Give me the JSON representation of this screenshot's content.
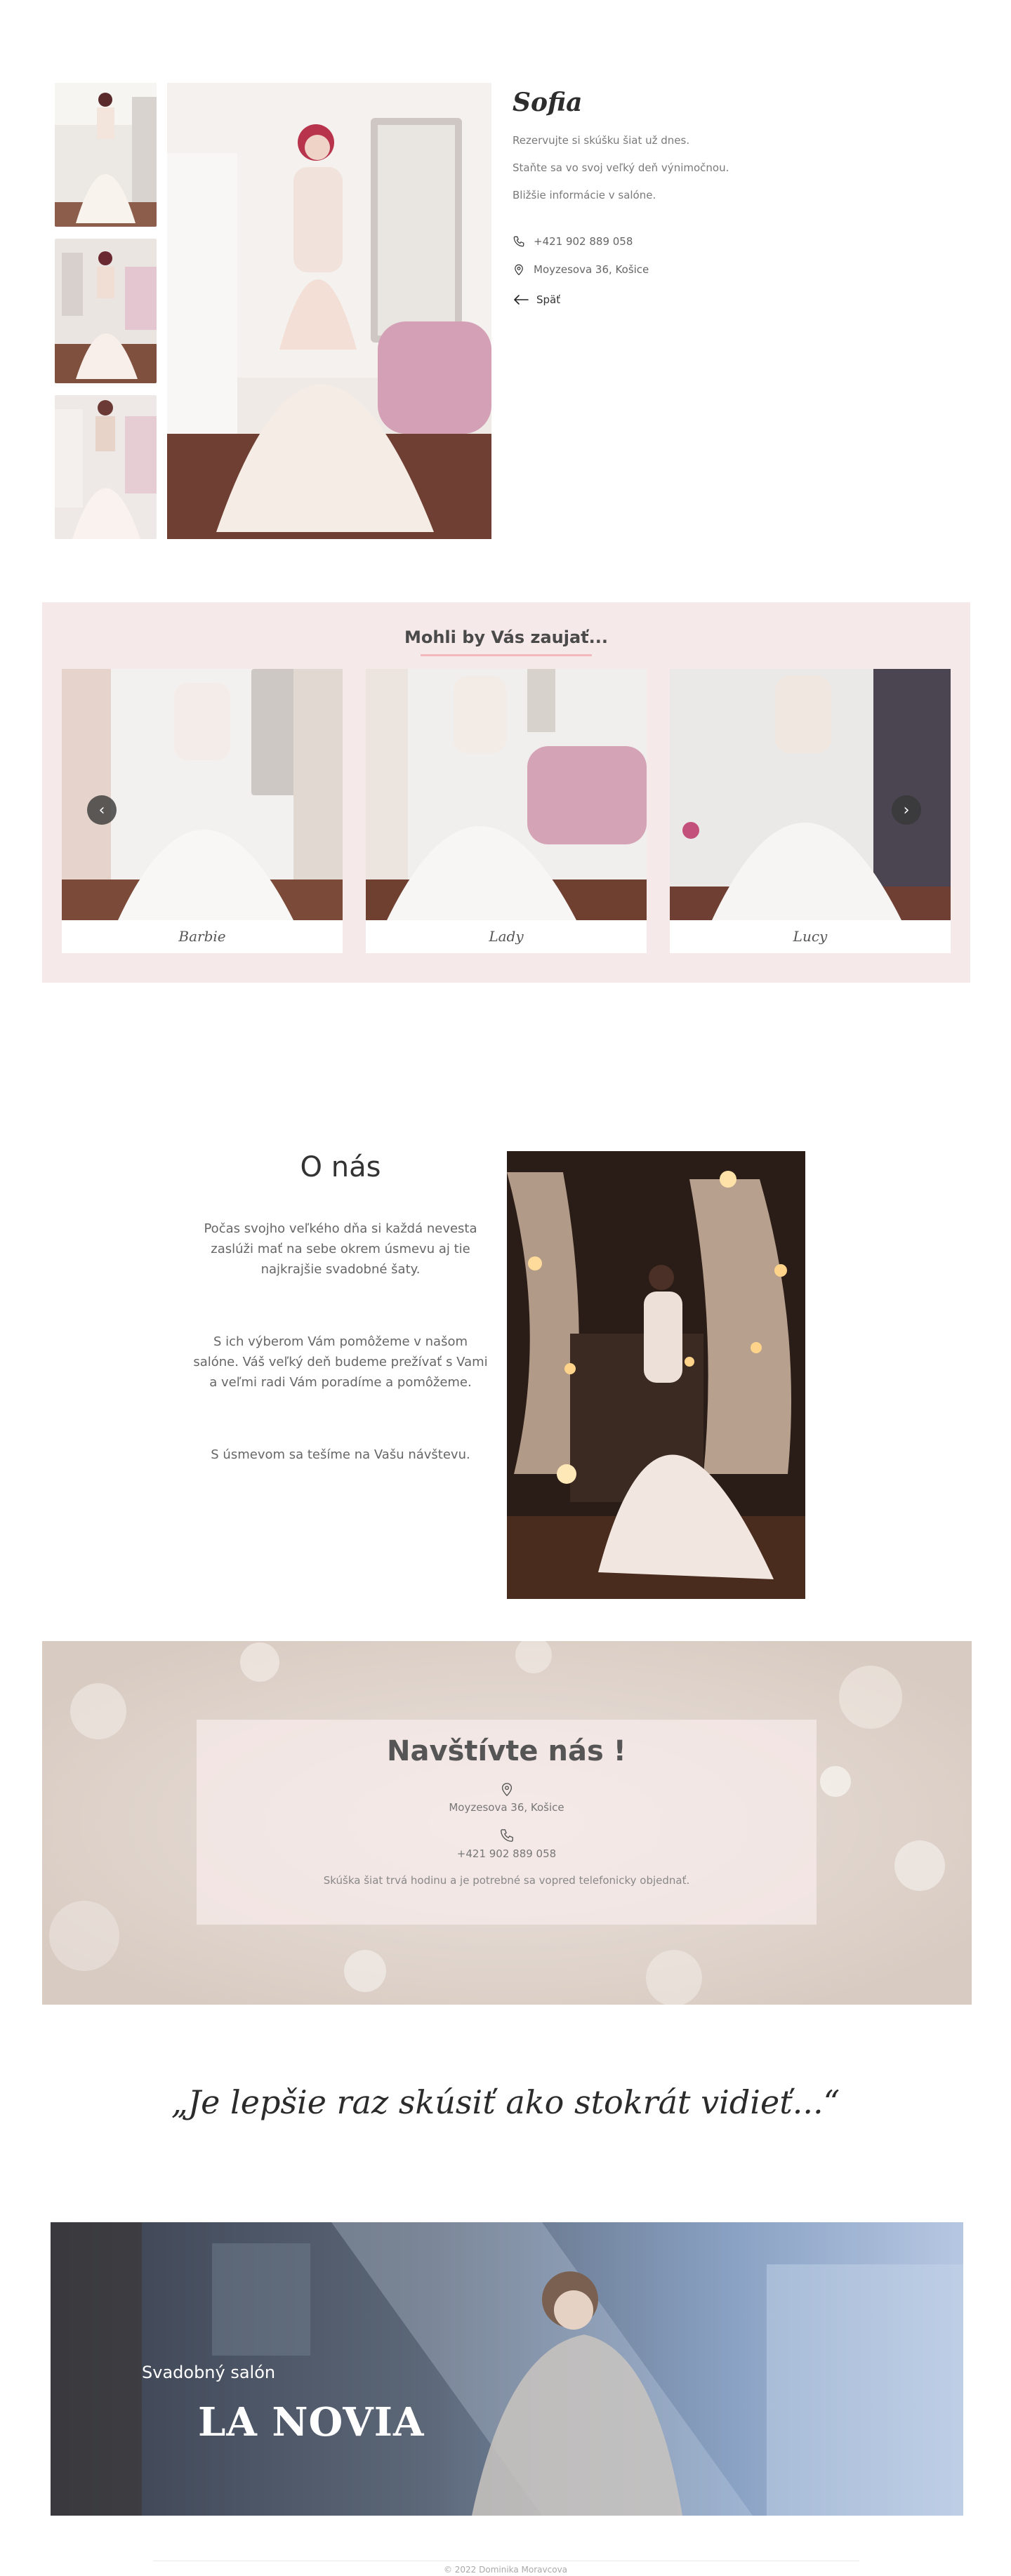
{
  "product": {
    "name": "Sofia",
    "lines": [
      "Rezervujte si skúšku šiat už dnes.",
      "Staňte sa vo svoj veľký deň výnimočnou.",
      "Bližšie informácie v salóne."
    ],
    "phone": "+421 902 889 058",
    "address": "Moyzesova 36, Košice",
    "back_label": "Späť"
  },
  "related": {
    "title": "Mohli by Vás zaujať...",
    "prev_icon": "‹",
    "next_icon": "›",
    "cards": [
      {
        "name": "Barbie"
      },
      {
        "name": "Lady"
      },
      {
        "name": "Lucy"
      }
    ]
  },
  "about": {
    "title": "O nás",
    "paragraphs": [
      "Počas svojho veľkého dňa si každá nevesta zaslúži mať na sebe okrem úsmevu aj tie najkrajšie svadobné šaty.",
      "S ich výberom Vám pomôžeme v našom salóne. Váš veľký deň budeme prežívať s Vami a veľmi radi Vám poradíme a pomôžeme.",
      "S úsmevom sa tešíme na Vašu návštevu."
    ]
  },
  "visit": {
    "title": "Navštívte nás !",
    "address": "Moyzesova 36, Košice",
    "phone": "+421 902 889 058",
    "note": "Skúška šiat trvá hodinu a je potrebné sa vopred telefonicky objednať."
  },
  "quote": "„Je lepšie raz skúsiť ako stokrát vidieť...“",
  "hero": {
    "subtitle": "Svadobný salón",
    "title": "LA NOVIA"
  },
  "footer": "© 2022 Dominika Moravcova",
  "icons": {
    "phone": "phone-icon",
    "location": "location-pin-icon",
    "back": "arrow-left-icon"
  },
  "colors": {
    "related_bg": "#f6e9ea",
    "accent_underline": "#f2b8bb",
    "visit_box": "#f8ecec"
  }
}
